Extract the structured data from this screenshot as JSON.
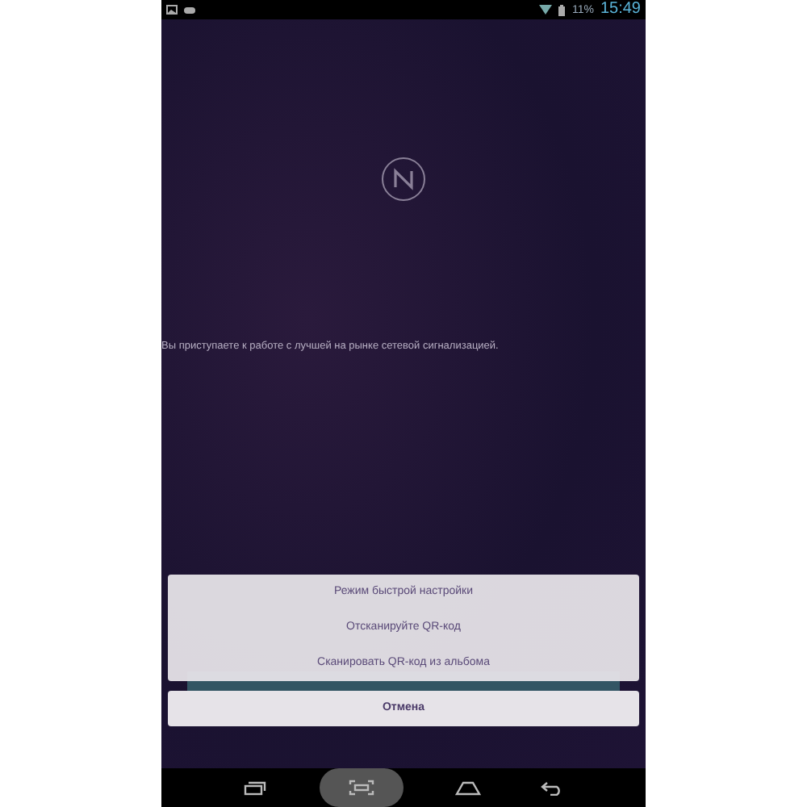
{
  "status_bar": {
    "battery": "11%",
    "time": "15:49"
  },
  "welcome_text": "Вы приступаете к работе с лучшей на рынке сетевой сигнализацией.",
  "action_sheet": {
    "items": [
      "Режим быстрой настройки",
      "Отсканируйте QR-код",
      "Сканировать QR-код из альбома"
    ],
    "cancel": "Отмена"
  },
  "nav_bar": [
    {
      "kind": "recent",
      "selected": false
    },
    {
      "kind": "screenshot",
      "selected": true
    },
    {
      "kind": "home",
      "selected": false
    },
    {
      "kind": "back",
      "selected": false
    }
  ]
}
